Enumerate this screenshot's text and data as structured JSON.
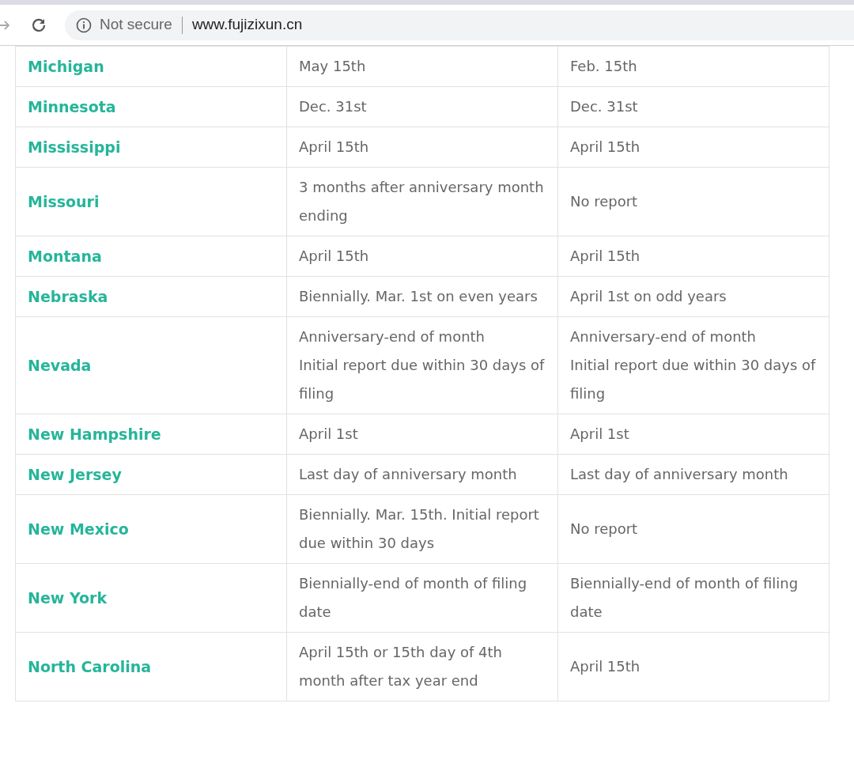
{
  "browser": {
    "security": "Not secure",
    "url": "www.fujizixun.cn"
  },
  "table": {
    "rows": [
      {
        "state": "Michigan",
        "column_2": "May 15th",
        "column_3": "Feb. 15th"
      },
      {
        "state": "Minnesota",
        "column_2": "Dec. 31st",
        "column_3": "Dec. 31st"
      },
      {
        "state": "Mississippi",
        "column_2": "April 15th",
        "column_3": "April 15th"
      },
      {
        "state": "Missouri",
        "column_2": "3 months after anniversary month ending",
        "column_3": "No report"
      },
      {
        "state": "Montana",
        "column_2": "April 15th",
        "column_3": "April 15th"
      },
      {
        "state": "Nebraska",
        "column_2": "Biennially. Mar. 1st on even years",
        "column_3": "April 1st on odd years"
      },
      {
        "state": "Nevada",
        "column_2": "Anniversary-end of month\nInitial report due within 30 days of filing",
        "column_3": "Anniversary-end of month\nInitial report due within 30 days of filing"
      },
      {
        "state": "New Hampshire",
        "column_2": "April 1st",
        "column_3": "April 1st"
      },
      {
        "state": "New Jersey",
        "column_2": "Last day of anniversary month",
        "column_3": "Last day of anniversary month"
      },
      {
        "state": "New Mexico",
        "column_2": "Biennially. Mar. 15th. Initial report due within 30 days",
        "column_3": "No report"
      },
      {
        "state": "New York",
        "column_2": "Biennially-end of month of filing date",
        "column_3": "Biennially-end of month of filing date"
      },
      {
        "state": "North Carolina",
        "column_2": "April 15th or 15th day of 4th month after tax year end",
        "column_3": "April 15th"
      }
    ]
  }
}
